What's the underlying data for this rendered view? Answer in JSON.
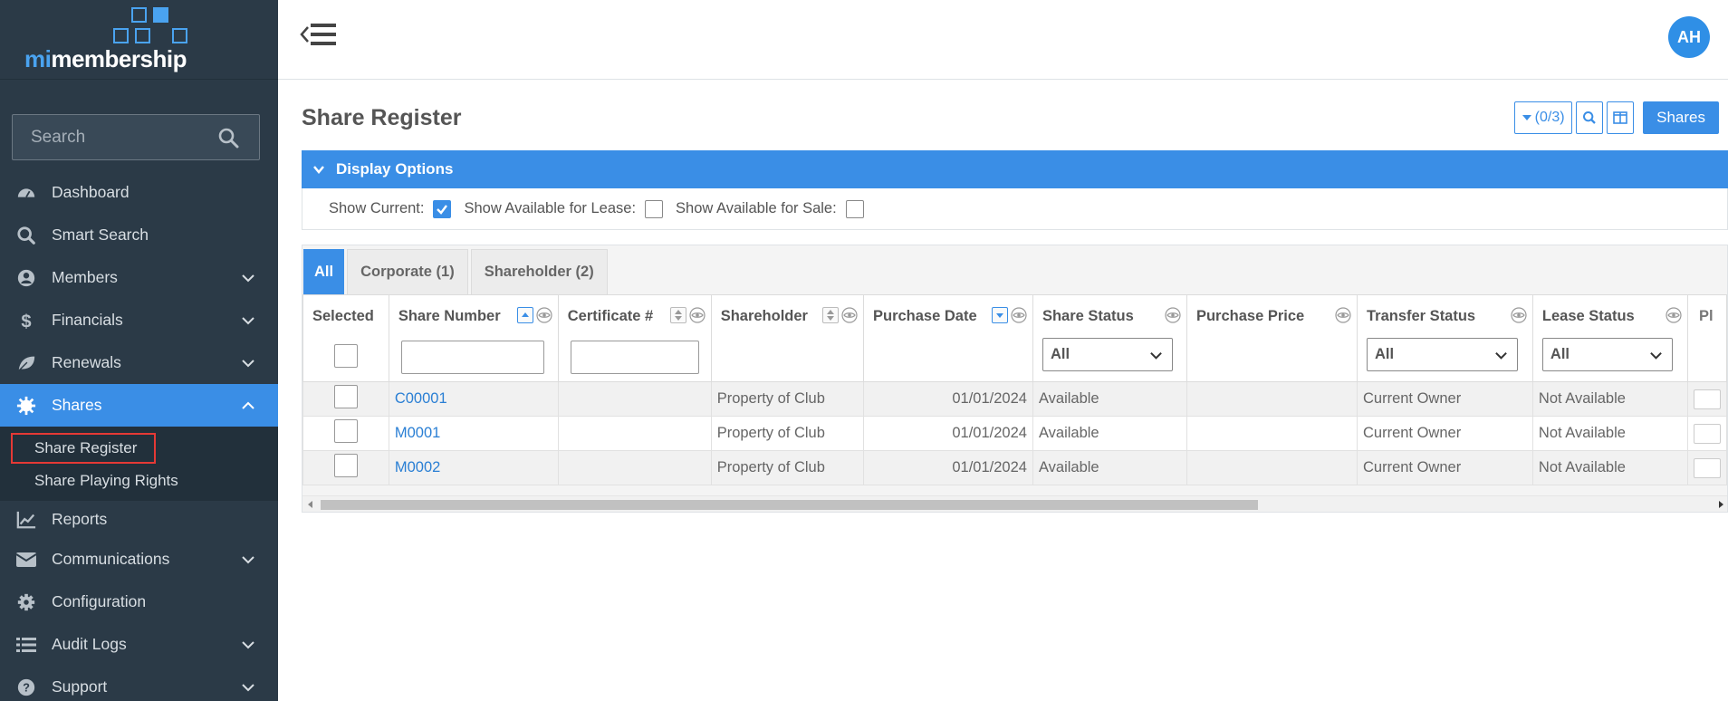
{
  "app": {
    "logo_prefix": "mi",
    "logo_suffix": "membership",
    "avatar_initials": "AH",
    "accent": "#3a8ee6"
  },
  "sidebar": {
    "search_placeholder": "Search",
    "items": [
      {
        "label": "Dashboard",
        "icon": "dashboard-icon"
      },
      {
        "label": "Smart Search",
        "icon": "search-icon"
      },
      {
        "label": "Members",
        "icon": "user-circle-icon",
        "expandable": true
      },
      {
        "label": "Financials",
        "icon": "dollar-icon",
        "expandable": true
      },
      {
        "label": "Renewals",
        "icon": "leaf-icon",
        "expandable": true
      },
      {
        "label": "Shares",
        "icon": "share-icon",
        "expandable": true,
        "expanded": true
      },
      {
        "label": "Reports",
        "icon": "chart-line-icon"
      },
      {
        "label": "Communications",
        "icon": "envelope-icon",
        "expandable": true
      },
      {
        "label": "Configuration",
        "icon": "gear-icon"
      },
      {
        "label": "Audit Logs",
        "icon": "list-icon",
        "expandable": true
      },
      {
        "label": "Support",
        "icon": "question-circle-icon",
        "expandable": true
      }
    ],
    "shares_sub": [
      {
        "label": "Share Register",
        "selected": true
      },
      {
        "label": "Share Playing Rights",
        "selected": false
      }
    ]
  },
  "page": {
    "title": "Share Register",
    "filter_button": "(0/3)",
    "shares_button": "Shares"
  },
  "display_options": {
    "header": "Display Options",
    "show_current": {
      "label": "Show Current:",
      "checked": true
    },
    "show_lease": {
      "label": "Show Available for Lease:",
      "checked": false
    },
    "show_sale": {
      "label": "Show Available for Sale:",
      "checked": false
    }
  },
  "tabs": [
    {
      "label": "All",
      "active": true
    },
    {
      "label": "Corporate (1)",
      "active": false
    },
    {
      "label": "Shareholder (2)",
      "active": false
    }
  ],
  "table": {
    "columns": [
      "Selected",
      "Share Number",
      "Certificate #",
      "Shareholder",
      "Purchase Date",
      "Share Status",
      "Purchase Price",
      "Transfer Status",
      "Lease Status",
      "Pl"
    ],
    "filters": {
      "share_status": "All",
      "transfer_status": "All",
      "lease_status": "All"
    },
    "rows": [
      {
        "share_number": "C00001",
        "certificate": "",
        "shareholder": "Property of Club",
        "purchase_date": "01/01/2024",
        "share_status": "Available",
        "purchase_price": "",
        "transfer_status": "Current Owner",
        "lease_status": "Not Available"
      },
      {
        "share_number": "M0001",
        "certificate": "",
        "shareholder": "Property of Club",
        "purchase_date": "01/01/2024",
        "share_status": "Available",
        "purchase_price": "",
        "transfer_status": "Current Owner",
        "lease_status": "Not Available"
      },
      {
        "share_number": "M0002",
        "certificate": "",
        "shareholder": "Property of Club",
        "purchase_date": "01/01/2024",
        "share_status": "Available",
        "purchase_price": "",
        "transfer_status": "Current Owner",
        "lease_status": "Not Available"
      }
    ]
  }
}
